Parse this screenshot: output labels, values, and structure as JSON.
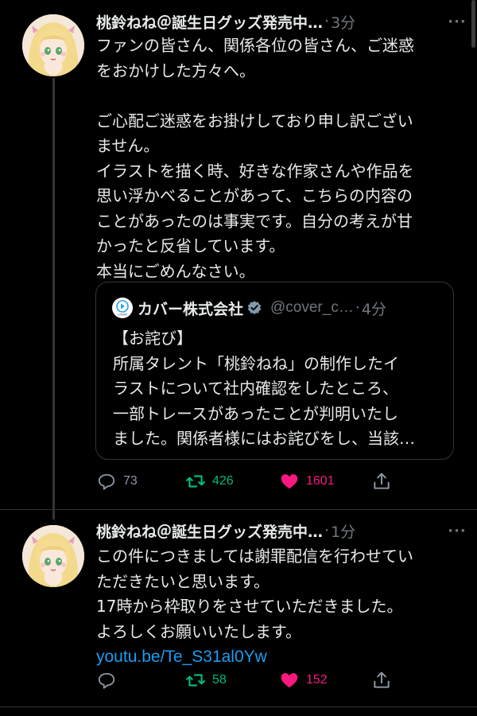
{
  "tweets": [
    {
      "author": "桃鈴ねね＠誕生日グッズ発売中…",
      "separator": "·",
      "time": "3分",
      "lines": [
        "ファンの皆さん、関係各位の皆さん、ご迷惑",
        "をおかけした方々へ。",
        "",
        "ご心配ご迷惑をお掛けしており申し訳ござい",
        "ません。",
        "イラストを描く時、好きな作家さんや作品を",
        "思い浮かべることがあって、こちらの内容の",
        "ことがあったのは事実です。自分の考えが甘",
        "かったと反省しています。",
        "本当にごめんなさい。"
      ],
      "quote": {
        "logo_label": "COVER",
        "name": "カバー株式会社",
        "handle": "@cover_c…",
        "separator": "·",
        "time": "4分",
        "lines": [
          "【お詫び】",
          "所属タレント「桃鈴ねね」の制作したイ",
          "ラストについて社内確認をしたところ、",
          "一部トレースがあったことが判明いたし",
          "ました。関係者様にはお詫びをし、当該…"
        ]
      },
      "stats": {
        "replies": "73",
        "retweets": "426",
        "likes": "1601"
      }
    },
    {
      "author": "桃鈴ねね＠誕生日グッズ発売中…",
      "separator": "·",
      "time": "1分",
      "lines": [
        "この件につきましては謝罪配信を行わせてい",
        "ただきたいと思います。",
        "17時から枠取りをさせていただきました。",
        "よろしくお願いいたします。"
      ],
      "link": "youtu.be/Te_S31al0Yw",
      "stats": {
        "replies": "",
        "retweets": "58",
        "likes": "152"
      }
    }
  ],
  "colors": {
    "background": "#000000",
    "text": "#e7e9ea",
    "muted": "#71767b",
    "link": "#1d9bf0",
    "retweet": "#00ba7c",
    "like": "#f91880",
    "verified": "#829aab"
  },
  "icons": [
    "more-icon",
    "reply-icon",
    "retweet-icon",
    "heart-icon",
    "share-icon",
    "verified-badge-icon",
    "cover-logo-icon"
  ]
}
